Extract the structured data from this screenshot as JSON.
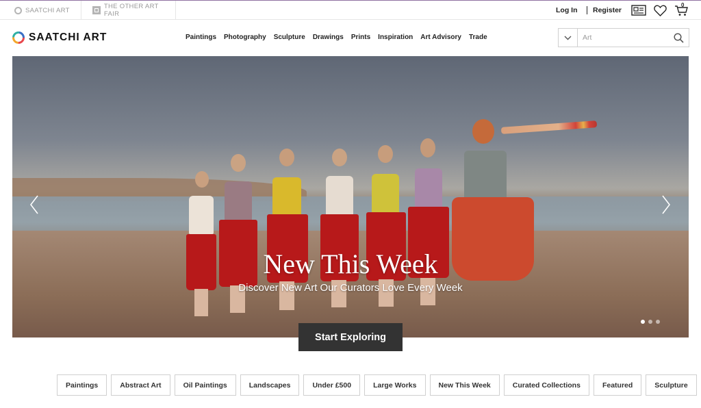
{
  "topbar": {
    "sites": [
      {
        "label": "SAATCHI ART"
      },
      {
        "label": "THE OTHER ART FAIR"
      }
    ],
    "login_label": "Log In",
    "register_label": "Register",
    "cart_count": "0",
    "icons": [
      "gift-card-icon",
      "heart-icon",
      "cart-icon"
    ]
  },
  "nav": {
    "logo_text": "SAATCHI ART",
    "links": [
      "Paintings",
      "Photography",
      "Sculpture",
      "Drawings",
      "Prints",
      "Inspiration",
      "Art Advisory",
      "Trade"
    ],
    "search": {
      "placeholder": "Art",
      "value": ""
    }
  },
  "hero": {
    "title": "New This Week",
    "subtitle": "Discover New Art Our Curators Love Every Week",
    "cta_label": "Start Exploring",
    "slides_count": 3,
    "active_slide": 1
  },
  "quick_links": [
    "Paintings",
    "Abstract Art",
    "Oil Paintings",
    "Landscapes",
    "Under £500",
    "Large Works",
    "New This Week",
    "Curated Collections",
    "Featured",
    "Sculpture"
  ],
  "colors": {
    "accent_bar": "#8e6fa0",
    "cta_bg": "#333333",
    "logo_ring": [
      "#e8474c",
      "#f3a72d",
      "#2fb0a3",
      "#3a6fc4"
    ]
  }
}
